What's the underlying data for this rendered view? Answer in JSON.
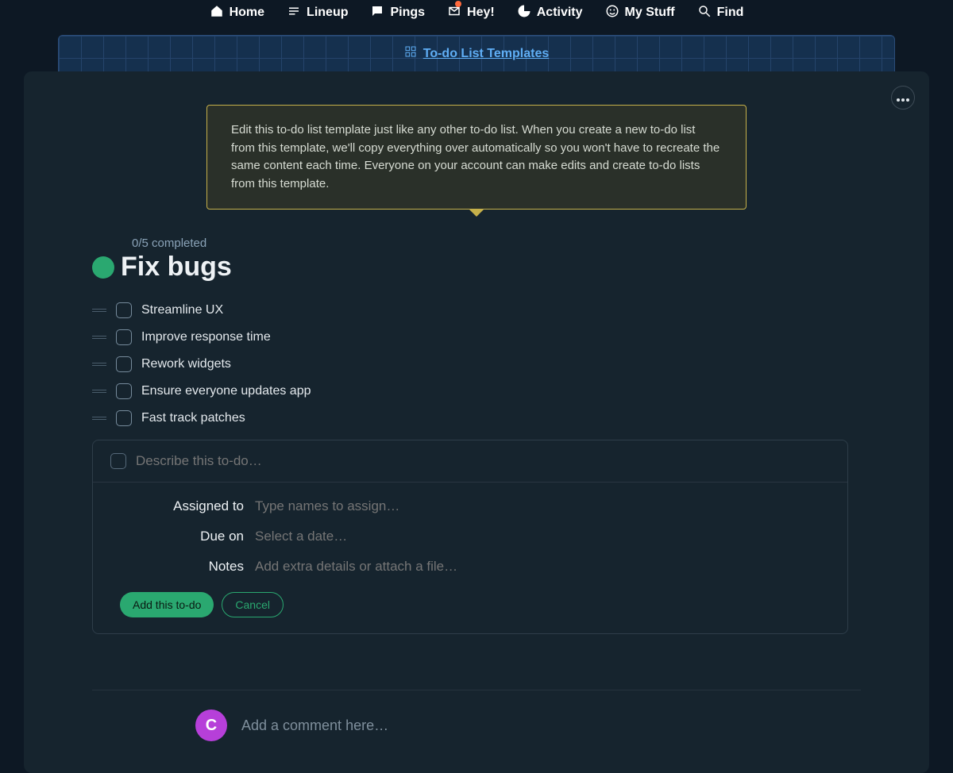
{
  "nav": {
    "home": "Home",
    "lineup": "Lineup",
    "pings": "Pings",
    "hey": "Hey!",
    "activity": "Activity",
    "mystuff": "My Stuff",
    "find": "Find"
  },
  "breadcrumb": {
    "link": "To-do List Templates"
  },
  "tip": "Edit this to-do list template just like any other to-do list. When you create a new to-do list from this template, we'll copy everything over automatically so you won't have to recreate the same content each time. Everyone on your account can make edits and create to-do lists from this template.",
  "list": {
    "completed": "0/5 completed",
    "title": "Fix bugs",
    "items": [
      "Streamline UX",
      "Improve response time",
      "Rework widgets",
      "Ensure everyone updates app",
      "Fast track patches"
    ]
  },
  "form": {
    "title_ph": "Describe this to-do…",
    "assigned_label": "Assigned to",
    "assigned_ph": "Type names to assign…",
    "due_label": "Due on",
    "due_ph": "Select a date…",
    "notes_label": "Notes",
    "notes_ph": "Add extra details or attach a file…",
    "submit": "Add this to-do",
    "cancel": "Cancel"
  },
  "comment": {
    "avatar_initial": "C",
    "placeholder": "Add a comment here…"
  }
}
